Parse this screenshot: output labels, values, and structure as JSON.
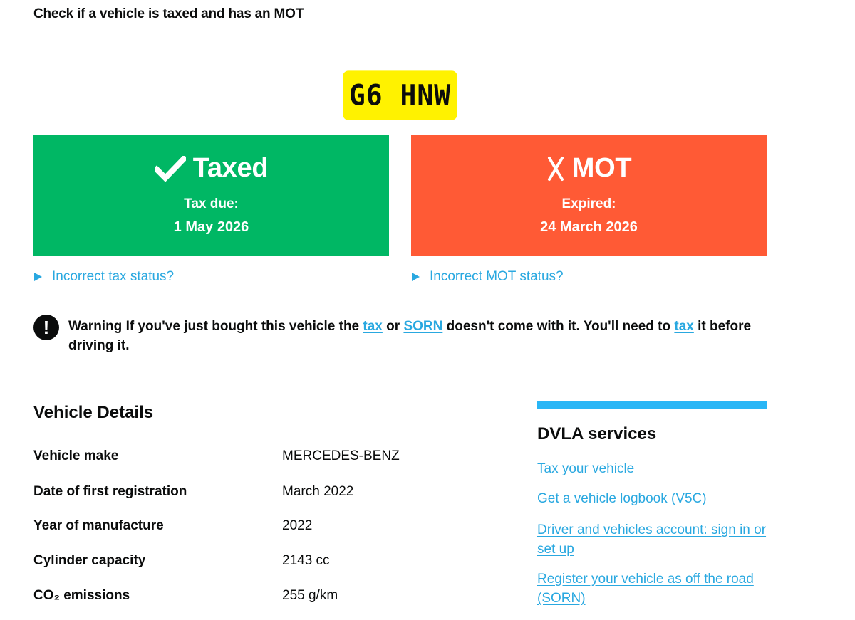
{
  "header": {
    "service_name": "Check if a vehicle is taxed and has an MOT"
  },
  "plate": "G6 HNW",
  "tax_status": {
    "title": "Taxed",
    "label": "Tax due:",
    "date": "1 May 2026",
    "color": "#00b764",
    "icon": "checkmark-icon"
  },
  "mot_status": {
    "title": "MOT",
    "label": "Expired:",
    "date": "24 March 2026",
    "color": "#ff5a35",
    "icon": "cross-icon"
  },
  "links": {
    "incorrect_tax": "Incorrect tax status?",
    "incorrect_mot": "Incorrect MOT status?"
  },
  "warning": {
    "icon": "!",
    "prefix": "Warning If you've just bought this vehicle the ",
    "link_tax": "tax",
    "or": " or ",
    "link_sorn": "SORN",
    "middle": " doesn't come with it. You'll need to ",
    "link_tax2": "tax",
    "suffix": " it before driving it."
  },
  "vehicle_details": {
    "title": "Vehicle Details",
    "rows": [
      {
        "label": "Vehicle make",
        "value": "MERCEDES-BENZ"
      },
      {
        "label": "Date of first registration",
        "value": "March 2022"
      },
      {
        "label": "Year of manufacture",
        "value": "2022"
      },
      {
        "label": "Cylinder capacity",
        "value": "2143 cc"
      },
      {
        "label": "CO₂ emissions",
        "value": "255 g/km"
      }
    ]
  },
  "dvla_services": {
    "title": "DVLA services",
    "links": [
      "Tax your vehicle",
      "Get a vehicle logbook (V5C)",
      "Driver and vehicles account: sign in or set up",
      "Register your vehicle as off the road (SORN)"
    ]
  },
  "colors": {
    "link": "#29a8e0",
    "accent_bar": "#29b6f6",
    "plate": "#fff200"
  }
}
